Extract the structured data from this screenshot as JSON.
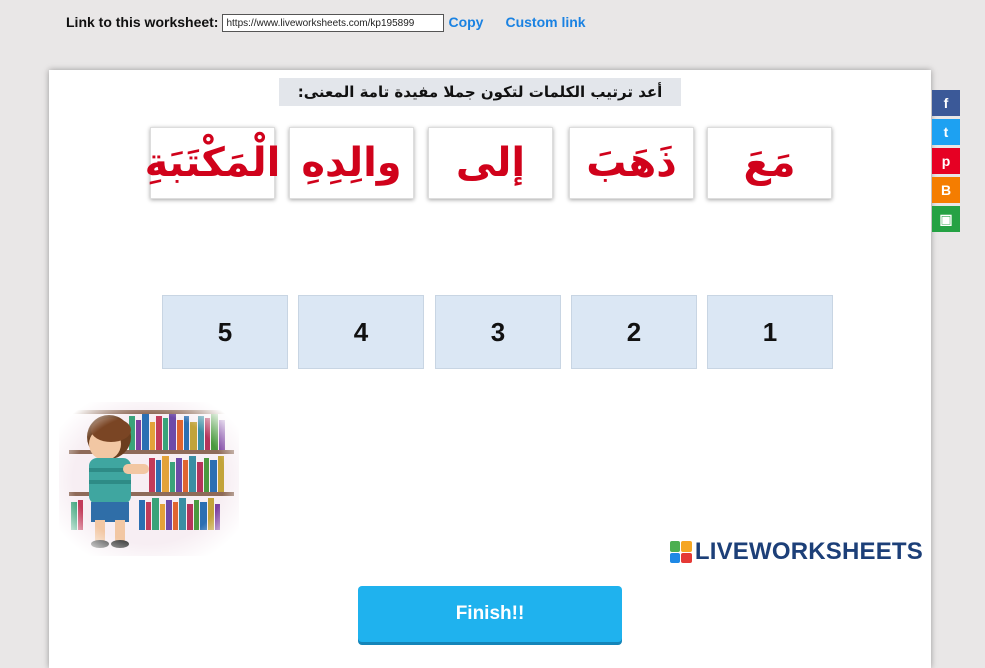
{
  "link_bar": {
    "label": "Link to this worksheet:",
    "url_value": "https://www.liveworksheets.com/kp195899",
    "copy_label": "Copy",
    "custom_link_label": "Custom link"
  },
  "worksheet": {
    "instruction": "أعد ترتيب الكلمات لتكون جملا مفيدة تامة المعنى:",
    "words": [
      "مَعَ",
      "ذَهَبَ",
      "إلى",
      "والِدِهِ",
      "الْمَكْتَبَةِ"
    ],
    "slots": [
      "1",
      "2",
      "3",
      "4",
      "5"
    ],
    "brand": "LIVEWORKSHEETS",
    "finish_label": "Finish!!"
  },
  "share": [
    {
      "icon": "facebook-icon",
      "glyph": "f",
      "color": "#3b5998"
    },
    {
      "icon": "twitter-icon",
      "glyph": "t",
      "color": "#1da1f2"
    },
    {
      "icon": "pinterest-icon",
      "glyph": "p",
      "color": "#e60023"
    },
    {
      "icon": "blogger-icon",
      "glyph": "B",
      "color": "#f57d00"
    },
    {
      "icon": "google-classroom-icon",
      "glyph": "▣",
      "color": "#25a244"
    }
  ],
  "colors": {
    "word_text": "#d0021b",
    "slot_bg": "#dbe7f4",
    "finish_bg": "#1fb2ee",
    "link": "#1a82e2",
    "brand": "#1c3f78"
  }
}
